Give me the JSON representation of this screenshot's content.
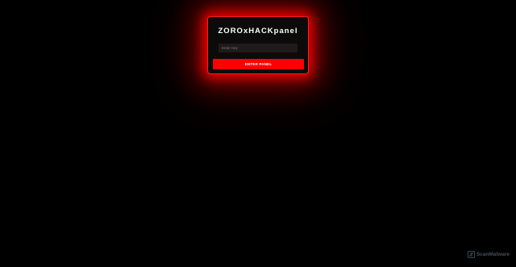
{
  "panel": {
    "title": "ZOROxHACKpanel",
    "key_input": {
      "placeholder": "Enter Key",
      "value": ""
    },
    "enter_button_label": "ENTER PANEL"
  },
  "watermark": {
    "text": "ScanMalware",
    "icon": "scanmalware-logo-icon"
  },
  "colors": {
    "background": "#000000",
    "accent": "#ff0000",
    "panel_background": "#0b0b0b",
    "title_text": "#ffffff"
  }
}
